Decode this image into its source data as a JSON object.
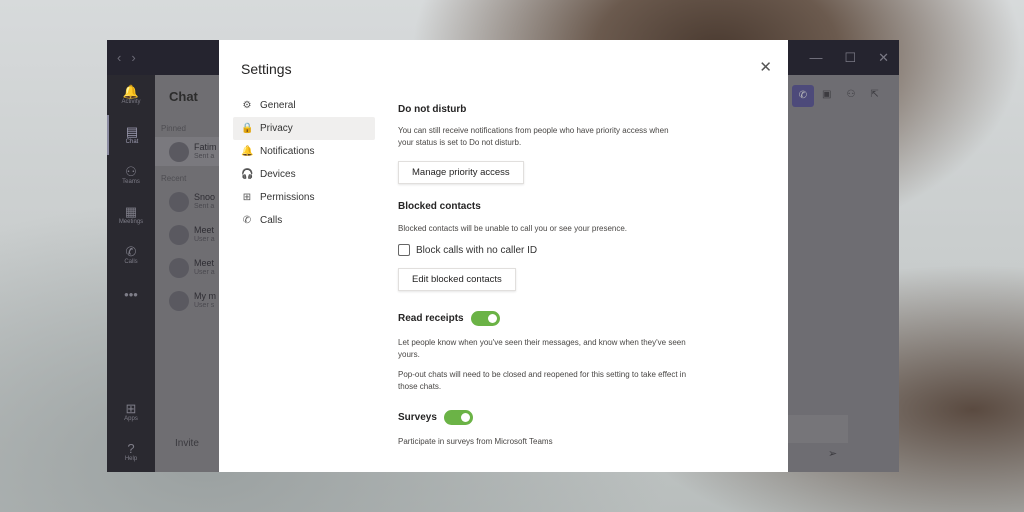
{
  "app": {
    "rail": [
      {
        "label": "Activity",
        "icon": "bell-icon",
        "glyph": "🔔"
      },
      {
        "label": "Chat",
        "icon": "chat-icon",
        "glyph": "▤"
      },
      {
        "label": "Teams",
        "icon": "teams-icon",
        "glyph": "⚇"
      },
      {
        "label": "Meetings",
        "icon": "calendar-icon",
        "glyph": "▦"
      },
      {
        "label": "Calls",
        "icon": "phone-icon",
        "glyph": "✆"
      },
      {
        "label": "",
        "icon": "more-icon",
        "glyph": "•••"
      }
    ],
    "rail_bottom": [
      {
        "label": "Apps",
        "icon": "apps-icon",
        "glyph": "⊞"
      },
      {
        "label": "Help",
        "icon": "help-icon",
        "glyph": "?"
      }
    ],
    "chat_title": "Chat",
    "pinned_label": "Pinned",
    "recent_label": "Recent",
    "pinned": [
      {
        "name": "Fatim",
        "sub": "Sent a"
      }
    ],
    "recent": [
      {
        "name": "Snoo",
        "sub": "Sent a"
      },
      {
        "name": "Meet",
        "sub": "User a"
      },
      {
        "name": "Meet",
        "sub": "User a"
      },
      {
        "name": "My m",
        "sub": "User s"
      }
    ],
    "invite": "Invite"
  },
  "settings": {
    "title": "Settings",
    "menu": [
      {
        "label": "General",
        "icon": "gear-icon",
        "glyph": "⚙"
      },
      {
        "label": "Privacy",
        "icon": "lock-icon",
        "glyph": "🔒"
      },
      {
        "label": "Notifications",
        "icon": "bell-icon",
        "glyph": "🔔"
      },
      {
        "label": "Devices",
        "icon": "headset-icon",
        "glyph": "🎧"
      },
      {
        "label": "Permissions",
        "icon": "permissions-icon",
        "glyph": "⊞"
      },
      {
        "label": "Calls",
        "icon": "phone-icon",
        "glyph": "✆"
      }
    ],
    "active": "Privacy",
    "dnd_title": "Do not disturb",
    "dnd_desc": "You can still receive notifications from people who have priority access when your status is set to Do not disturb.",
    "manage_btn": "Manage priority access",
    "blocked_title": "Blocked contacts",
    "blocked_desc": "Blocked contacts will be unable to call you or see your presence.",
    "block_checkbox": "Block calls with no caller ID",
    "block_checked": false,
    "edit_btn": "Edit blocked contacts",
    "read_title": "Read receipts",
    "read_on": true,
    "read_desc1": "Let people know when you've seen their messages, and know when they've seen yours.",
    "read_desc2": "Pop-out chats will need to be closed and reopened for this setting to take effect in those chats.",
    "surveys_title": "Surveys",
    "surveys_on": true,
    "surveys_desc": "Participate in surveys from Microsoft Teams",
    "toggle_color": "#6bb346"
  }
}
